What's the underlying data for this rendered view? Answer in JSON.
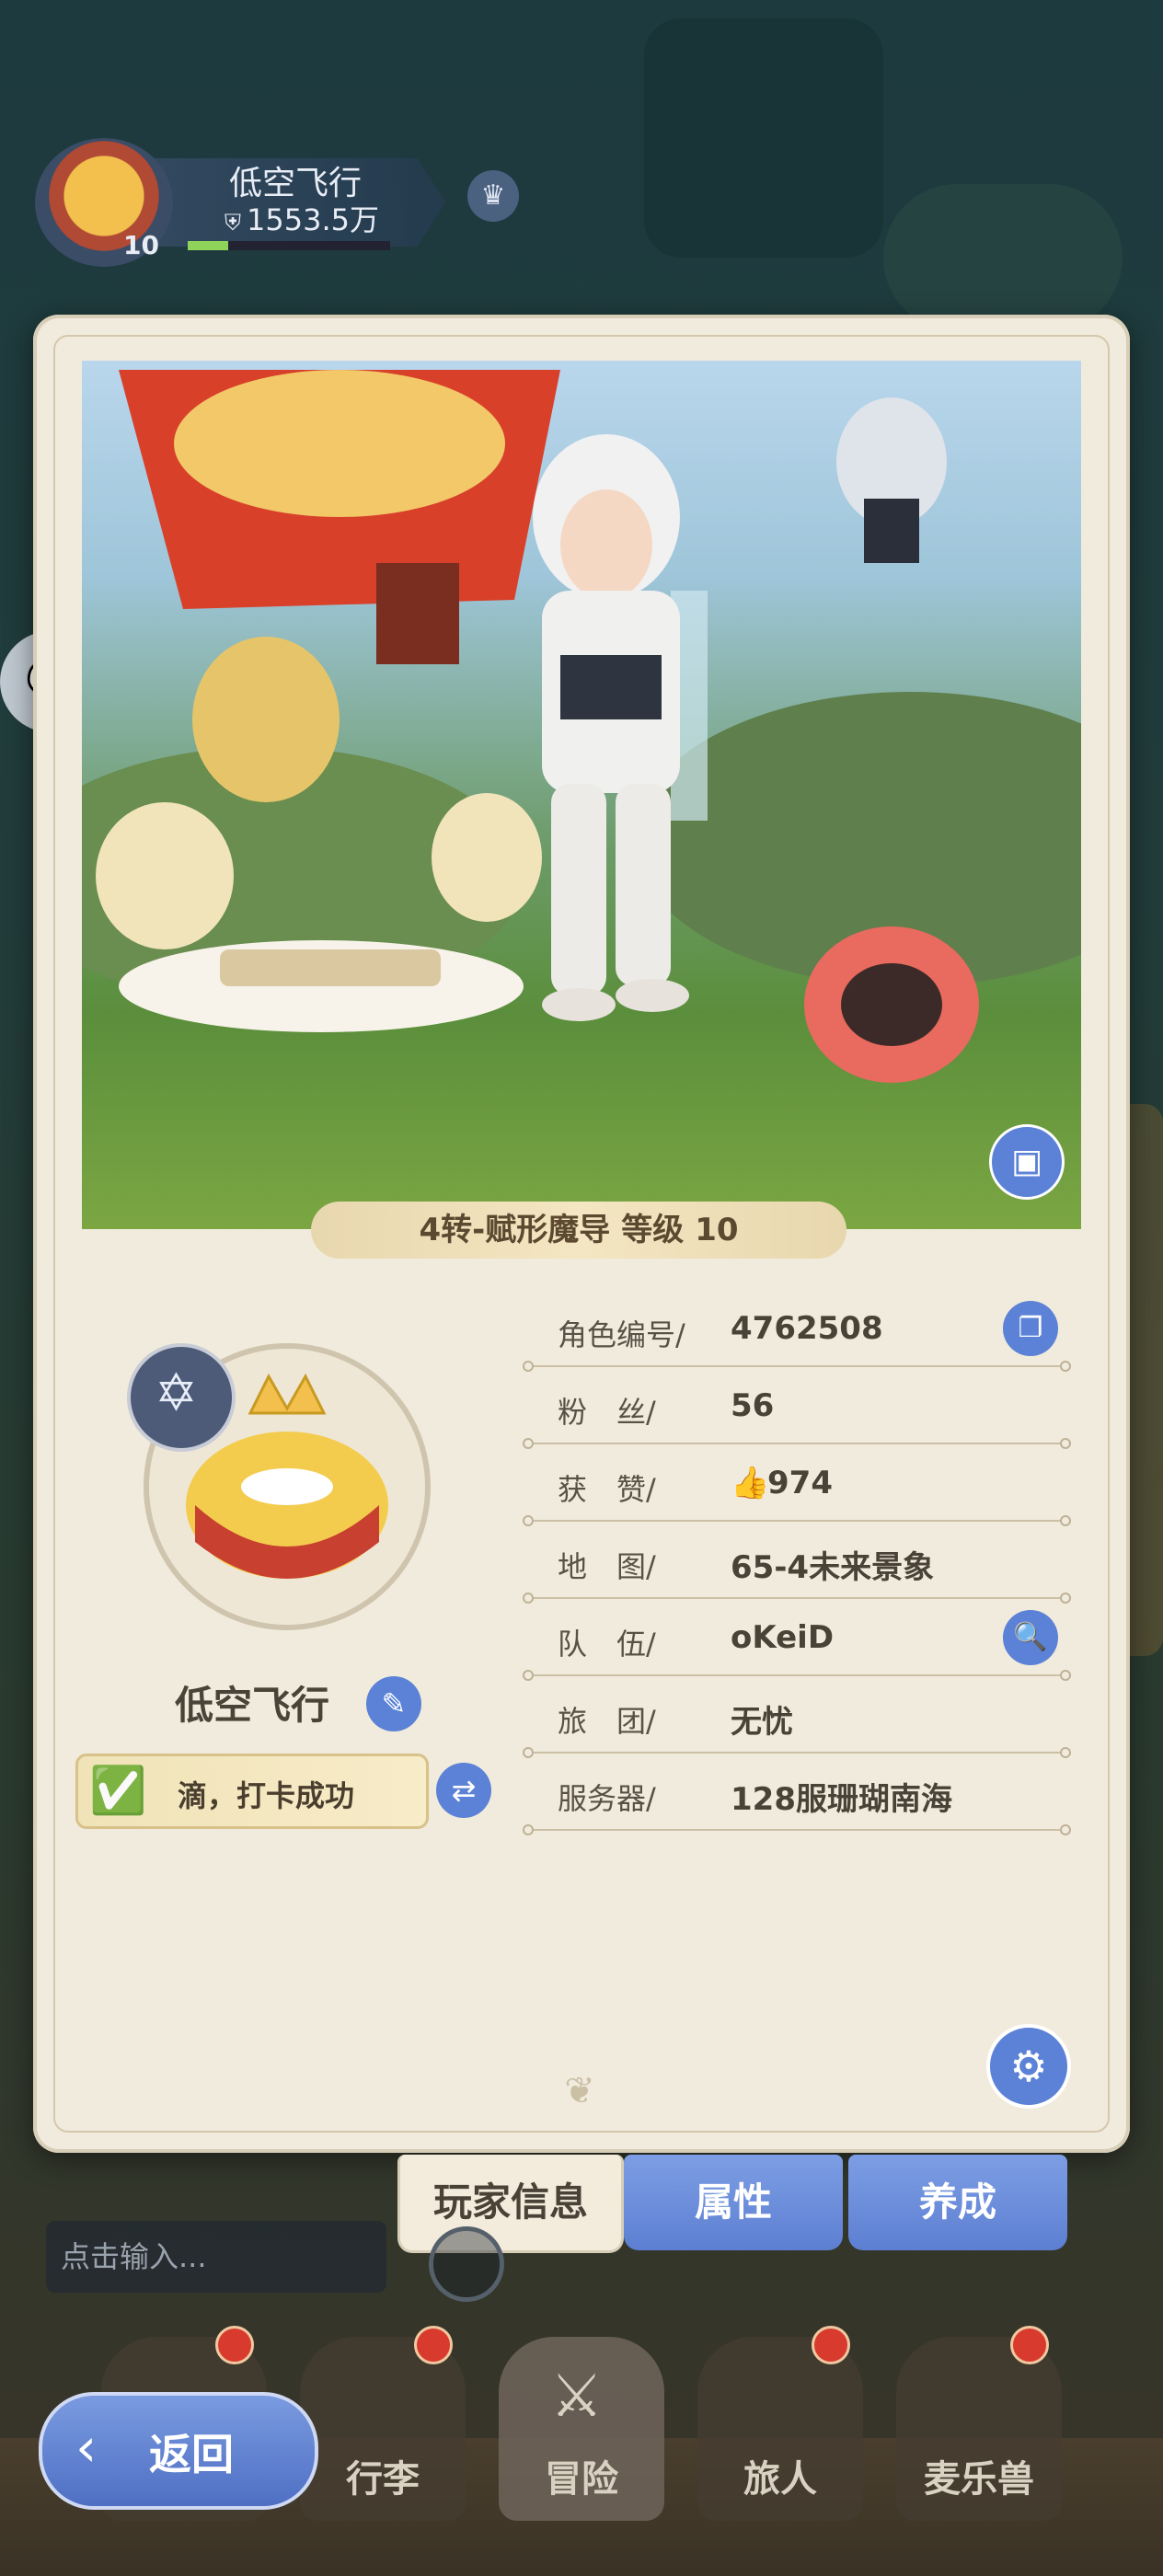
{
  "hud": {
    "player_name": "低空飞行",
    "power": "1553.5万",
    "level": "10",
    "level_progress": 0.2
  },
  "showcase": {
    "caption_class": "4转-赋形魔导",
    "caption_level_label": "等级",
    "caption_level": "10"
  },
  "profile": {
    "name": "低空飞行",
    "signin_text": "滴，打卡成功"
  },
  "info": [
    {
      "label": "角色编号/",
      "value": "4762508",
      "action_icon": "copy-icon"
    },
    {
      "label": "粉　丝/",
      "value": "56"
    },
    {
      "label": "获　赞/",
      "value": "974",
      "icon": "thumbs-up-icon"
    },
    {
      "label": "地　图/",
      "value": "65-4未来景象"
    },
    {
      "label": "队　伍/",
      "value": "oKeiD",
      "action_icon": "search-icon"
    },
    {
      "label": "旅　团/",
      "value": "无忧"
    },
    {
      "label": "服务器/",
      "value": "128服珊瑚南海"
    }
  ],
  "tabs": [
    {
      "label": "玩家信息",
      "active": true
    },
    {
      "label": "属性",
      "active": false
    },
    {
      "label": "养成",
      "active": false
    }
  ],
  "chat": {
    "placeholder": "点击输入..."
  },
  "bottom_nav": [
    {
      "label": "行李",
      "badge": true
    },
    {
      "label": "冒险",
      "badge": false
    },
    {
      "label": "旅人",
      "badge": true
    },
    {
      "label": "麦乐兽",
      "badge": true
    }
  ],
  "back_button": {
    "label": "返回"
  },
  "colors": {
    "accent_blue": "#5b82d6",
    "panel_bg": "#f1ebdd",
    "badge_red": "#d83a2e"
  }
}
